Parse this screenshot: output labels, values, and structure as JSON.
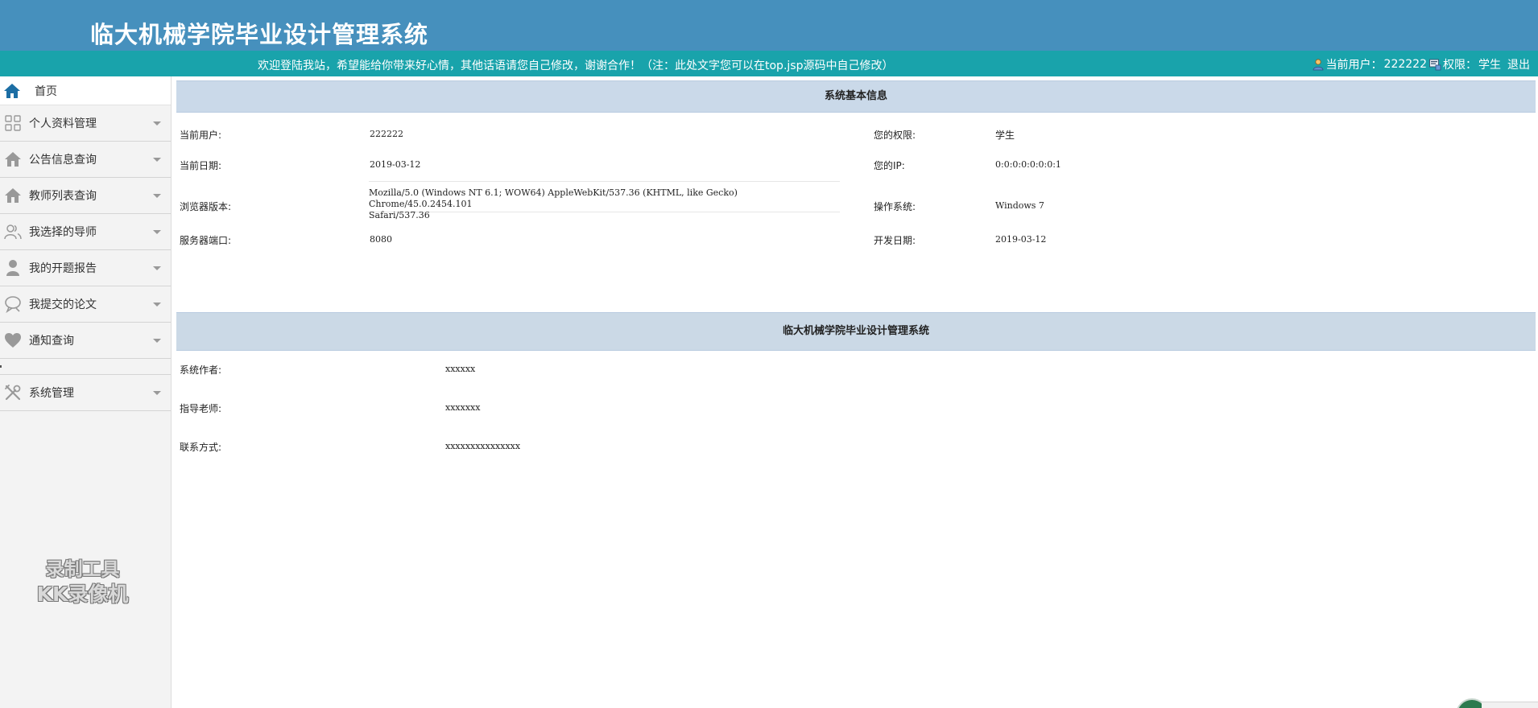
{
  "header": {
    "title": "临大机械学院毕业设计管理系统"
  },
  "notice": {
    "text": "欢迎登陆我站，希望能给你带来好心情，其他话语请您自己修改，谢谢合作！（注：此处文字您可以在top.jsp源码中自己修改）"
  },
  "user_bar": {
    "current_user_label": "当前用户：",
    "current_user": "222222",
    "permission_label": "权限：",
    "permission": "学生",
    "logout": "退出"
  },
  "sidebar": {
    "items": [
      {
        "label": "首页",
        "icon": "home-icon"
      },
      {
        "label": "个人资料管理",
        "icon": "grid-icon"
      },
      {
        "label": "公告信息查询",
        "icon": "house-icon"
      },
      {
        "label": "教师列表查询",
        "icon": "house-icon"
      },
      {
        "label": "我选择的导师",
        "icon": "users-icon"
      },
      {
        "label": "我的开题报告",
        "icon": "person-icon"
      },
      {
        "label": "我提交的论文",
        "icon": "chat-icon"
      },
      {
        "label": "通知查询",
        "icon": "heart-icon"
      },
      {
        "label": "系统管理",
        "icon": "tools-icon"
      }
    ]
  },
  "watermark": {
    "line1": "录制工具",
    "line2": "KK录像机"
  },
  "system_info": {
    "title": "系统基本信息",
    "rows": [
      {
        "label1": "当前用户:",
        "value1": "222222",
        "label2": "您的权限:",
        "value2": "学生"
      },
      {
        "label1": "当前日期:",
        "value1": "2019-03-12",
        "label2": "您的IP:",
        "value2": "0:0:0:0:0:0:0:1"
      },
      {
        "label1": "浏览器版本:",
        "value1_line1": "Mozilla/5.0 (Windows NT 6.1; WOW64) AppleWebKit/537.36 (KHTML, like Gecko) Chrome/45.0.2454.101",
        "value1_line2": "Safari/537.36",
        "label2": "操作系统:",
        "value2": "Windows 7"
      },
      {
        "label1": "服务器端口:",
        "value1": "8080",
        "label2": "开发日期:",
        "value2": "2019-03-12"
      }
    ]
  },
  "about": {
    "title": "临大机械学院毕业设计管理系统",
    "rows": [
      {
        "label": "系统作者:",
        "value": "xxxxxx"
      },
      {
        "label": "指导老师:",
        "value": "xxxxxxx"
      },
      {
        "label": "联系方式:",
        "value": "xxxxxxxxxxxxxxx"
      }
    ]
  },
  "colors": {
    "header_bg": "#4690bd",
    "notice_bg": "#19a3ab",
    "panel_head_bg": "#cad9e9",
    "sidebar_bg": "#f3f3f3"
  }
}
